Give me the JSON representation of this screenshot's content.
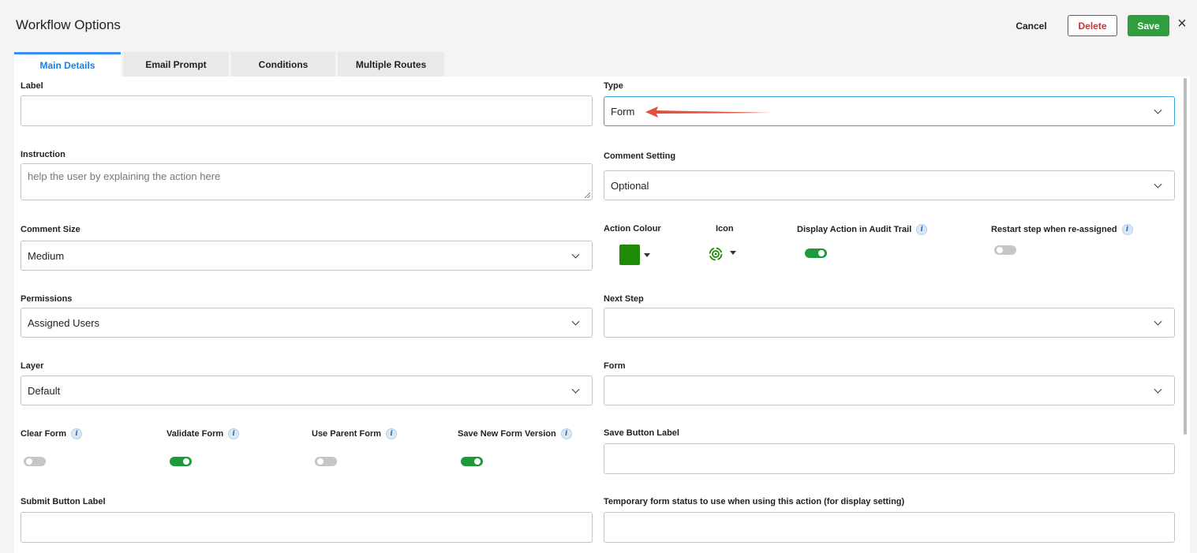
{
  "header": {
    "title": "Workflow Options",
    "cancel_label": "Cancel",
    "delete_label": "Delete",
    "save_label": "Save",
    "close_symbol": "×"
  },
  "tabs": [
    {
      "label": "Main Details",
      "active": true
    },
    {
      "label": "Email Prompt",
      "active": false
    },
    {
      "label": "Conditions",
      "active": false
    },
    {
      "label": "Multiple Routes",
      "active": false
    }
  ],
  "form": {
    "label": {
      "title": "Label",
      "value": ""
    },
    "type": {
      "title": "Type",
      "value": "Form"
    },
    "instruction": {
      "title": "Instruction",
      "placeholder": "help the user by explaining the action here"
    },
    "comment_setting": {
      "title": "Comment Setting",
      "value": "Optional"
    },
    "comment_size": {
      "title": "Comment Size",
      "value": "Medium"
    },
    "action_colour": {
      "title": "Action Colour",
      "color": "#1e8a05"
    },
    "icon": {
      "title": "Icon",
      "icon_name": "gear-cycle-icon"
    },
    "display_in_audit": {
      "title": "Display Action in Audit Trail",
      "on": true
    },
    "restart_step": {
      "title": "Restart step when re-assigned",
      "on": false
    },
    "permissions": {
      "title": "Permissions",
      "value": "Assigned Users"
    },
    "next_step": {
      "title": "Next Step",
      "value": ""
    },
    "layer": {
      "title": "Layer",
      "value": "Default"
    },
    "form_select": {
      "title": "Form",
      "value": ""
    },
    "clear_form": {
      "title": "Clear Form",
      "on": false
    },
    "validate_form": {
      "title": "Validate Form",
      "on": true
    },
    "use_parent_form": {
      "title": "Use Parent Form",
      "on": false
    },
    "save_new_form_version": {
      "title": "Save New Form Version",
      "on": true
    },
    "save_button_label": {
      "title": "Save Button Label",
      "value": ""
    },
    "submit_button_label": {
      "title": "Submit Button Label",
      "value": ""
    },
    "temp_form_status": {
      "title": "Temporary form status to use when using this action (for display setting)",
      "value": ""
    }
  },
  "colors": {
    "accent": "#1e7fe0",
    "danger": "#d32f2f",
    "success": "#2e9e3e",
    "annotation_arrow": "#e0503a"
  }
}
